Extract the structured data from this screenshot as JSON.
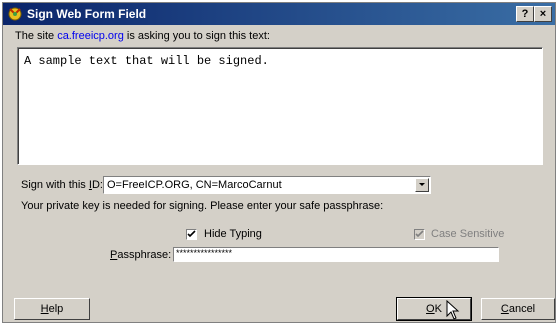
{
  "window": {
    "title": "Sign Web Form Field",
    "help_btn": "?",
    "close_btn": "×",
    "icon": "certificate-icon"
  },
  "prompt": {
    "prefix": "The site ",
    "site": "ca.freeicp.org",
    "suffix": " is asking you to sign this text:"
  },
  "text_to_sign": "A sample text that will be signed.",
  "id_select": {
    "label": "Sign with this ID:",
    "value": "O=FreeICP.ORG, CN=MarcoCarnut"
  },
  "key_message": "Your private key is needed for signing. Please enter your safe passphrase:",
  "options": {
    "hide_typing": {
      "label": "Hide Typing",
      "checked": true
    },
    "case_sensitive": {
      "label": "Case Sensitive",
      "checked": true,
      "enabled": false
    }
  },
  "passphrase": {
    "label": "Passphrase:",
    "value": "****************"
  },
  "buttons": {
    "help": "Help",
    "ok": "OK",
    "cancel": "Cancel"
  }
}
